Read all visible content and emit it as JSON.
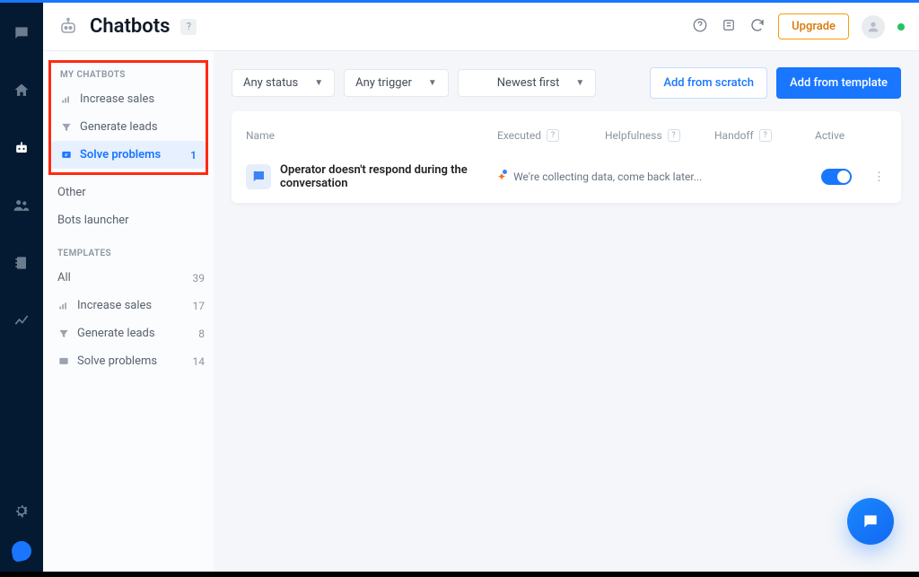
{
  "header": {
    "title": "Chatbots",
    "upgrade_label": "Upgrade"
  },
  "sidebar": {
    "my_title": "MY CHATBOTS",
    "templates_title": "TEMPLATES",
    "my": [
      {
        "label": "Increase sales",
        "count": ""
      },
      {
        "label": "Generate leads",
        "count": ""
      },
      {
        "label": "Solve problems",
        "count": "1"
      }
    ],
    "other_label": "Other",
    "launcher_label": "Bots launcher",
    "templates": [
      {
        "label": "All",
        "count": "39"
      },
      {
        "label": "Increase sales",
        "count": "17"
      },
      {
        "label": "Generate leads",
        "count": "8"
      },
      {
        "label": "Solve problems",
        "count": "14"
      }
    ]
  },
  "toolbar": {
    "status": "Any status",
    "trigger": "Any trigger",
    "sort": "Newest first",
    "add_scratch": "Add from scratch",
    "add_template": "Add from template"
  },
  "table": {
    "headers": {
      "name": "Name",
      "executed": "Executed",
      "helpfulness": "Helpfulness",
      "handoff": "Handoff",
      "active": "Active"
    },
    "rows": [
      {
        "name": "Operator doesn't respond during the conversation",
        "collecting": "We're collecting data, come back later...",
        "active": true
      }
    ]
  }
}
